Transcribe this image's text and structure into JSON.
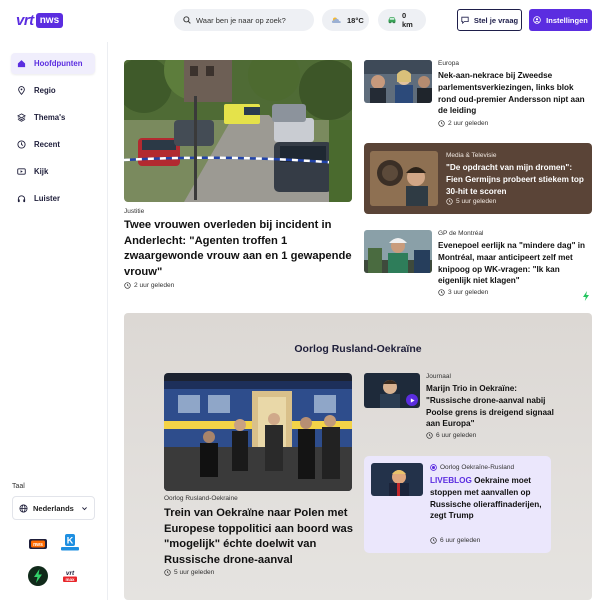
{
  "header": {
    "logo_vrt": "vrt",
    "logo_nws": "nws",
    "search_placeholder": "Waar ben je naar op zoek?",
    "weather": "18°C",
    "traffic": "0 km",
    "question_label": "Stel je vraag",
    "settings_label": "Instellingen"
  },
  "sidebar": {
    "items": [
      {
        "label": "Hoofdpunten",
        "icon": "home-icon",
        "active": true
      },
      {
        "label": "Regio",
        "icon": "location-pin-icon"
      },
      {
        "label": "Thema's",
        "icon": "layers-icon"
      },
      {
        "label": "Recent",
        "icon": "clock-icon"
      },
      {
        "label": "Kijk",
        "icon": "play-box-icon"
      },
      {
        "label": "Luister",
        "icon": "headphones-icon"
      }
    ],
    "language_label": "Taal",
    "language_value": "Nederlands",
    "brands": [
      "vrt-nws-app-icon",
      "ketnet-app-icon",
      "radio-app-icon",
      "vrt-max-app-icon"
    ]
  },
  "hero": {
    "category": "Justitie",
    "headline": "Twee vrouwen overleden bij incident in Anderlecht: \"Agenten troffen 1 zwaargewonde vrouw aan en 1 gewapende vrouw\"",
    "time": "2 uur geleden"
  },
  "side_articles": [
    {
      "category": "Europa",
      "headline": "Nek-aan-nekrace bij Zweedse parlementsverkiezingen, links blok rond oud-premier Andersson nipt aan de leiding",
      "time": "2 uur geleden"
    },
    {
      "category": "Media & Televisie",
      "headline": "\"De opdracht van mijn dromen\": Fien Germijns probeert stiekem top 30-hit te scoren",
      "time": "5 uur geleden"
    },
    {
      "category": "GP de Montréal",
      "headline": "Evenepoel eerlijk na \"mindere dag\" in Montréal, maar anticipeert zelf met knipoog op WK-vragen: \"Ik kan eigenlijk niet klagen\"",
      "time": "3 uur geleden"
    }
  ],
  "war": {
    "title": "Oorlog Rusland-Oekraïne",
    "main": {
      "category": "Oorlog Rusland-Oekraine",
      "headline": "Trein van Oekraïne naar Polen met Europese toppolitici aan boord was \"mogelijk\" échte doelwit van Russische drone-aanval",
      "time": "5 uur geleden"
    },
    "journal": {
      "category": "Journaal",
      "headline": "Marijn Trio in Oekraïne: \"Russische drone-aanval nabij Poolse grens is dreigend signaal aan Europa\"",
      "time": "6 uur geleden"
    },
    "liveblog": {
      "category": "Oorlog Oekraïne-Rusland",
      "live_label": "LIVEBLOG",
      "headline": "Oekraine moet stoppen met aanvallen op Russische olieraffinaderijen, zegt Trump",
      "time": "6 uur geleden"
    }
  },
  "colors": {
    "accent": "#5b2de0",
    "navy": "#1e1e3a",
    "section_bg": "#dcd8d4",
    "live_card_bg": "#ebe7fc",
    "flash": "#22c55e"
  }
}
